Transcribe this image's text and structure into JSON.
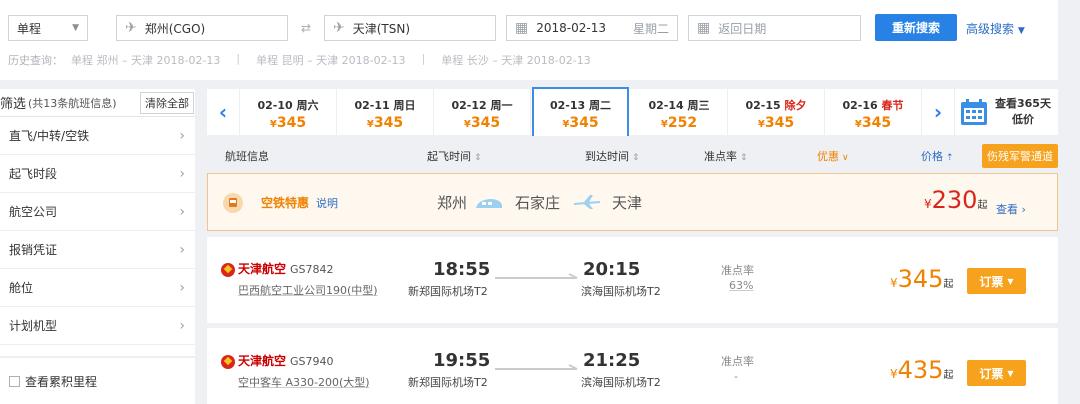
{
  "search": {
    "trip_type": "单程",
    "from": "郑州(CGO)",
    "to": "天津(TSN)",
    "date": "2018-02-13",
    "weekday": "星期二",
    "return_placeholder": "返回日期",
    "search_button": "重新搜索",
    "advanced": "高级搜索"
  },
  "history": {
    "label": "历史查询：",
    "items": [
      "单程 郑州 – 天津  2018-02-13",
      "单程 昆明 – 天津  2018-02-13",
      "单程 长沙 – 天津  2018-02-13"
    ]
  },
  "sidebar": {
    "title": "筛选",
    "count": "(共13条航班信息)",
    "clear": "清除全部",
    "items": [
      "直飞/中转/空铁",
      "起飞时段",
      "航空公司",
      "报销凭证",
      "舱位",
      "计划机型"
    ],
    "cumulative": "查看累积里程"
  },
  "date_tabs": [
    {
      "date": "02-10 周六",
      "price": "345"
    },
    {
      "date": "02-11 周日",
      "price": "345"
    },
    {
      "date": "02-12 周一",
      "price": "345"
    },
    {
      "date": "02-13 周二",
      "price": "345"
    },
    {
      "date": "02-14 周三",
      "price": "252"
    },
    {
      "date": "02-15",
      "holiday": "除夕",
      "price": "345"
    },
    {
      "date": "02-16",
      "holiday": "春节",
      "price": "345"
    }
  ],
  "currency": "¥",
  "calendar": {
    "line1": "查看365天",
    "line2": "低价"
  },
  "table_header": {
    "flight_info": "航班信息",
    "depart": "起飞时间",
    "arrive": "到达时间",
    "ontime": "准点率",
    "discount": "优惠",
    "price": "价格",
    "special": "伤残军警通道"
  },
  "rail": {
    "title": "空铁特惠",
    "explain": "说明",
    "from": "郑州",
    "via": "石家庄",
    "to": "天津",
    "price": "230",
    "suffix": "起",
    "view": "查看"
  },
  "flights": [
    {
      "airline": "天津航空",
      "number": "GS7842",
      "aircraft": "巴西航空工业公司190(中型)",
      "dep_time": "18:55",
      "dep_airport": "新郑国际机场T2",
      "arr_time": "20:15",
      "arr_airport": "滨海国际机场T2",
      "ontime_label": "准点率",
      "ontime": "63%",
      "price": "345",
      "suffix": "起",
      "book": "订票"
    },
    {
      "airline": "天津航空",
      "number": "GS7940",
      "aircraft": "空中客车 A330-200(大型)",
      "dep_time": "19:55",
      "dep_airport": "新郑国际机场T2",
      "arr_time": "21:25",
      "arr_airport": "滨海国际机场T2",
      "ontime_label": "准点率",
      "ontime": "-",
      "price": "435",
      "suffix": "起",
      "book": "订票"
    }
  ]
}
